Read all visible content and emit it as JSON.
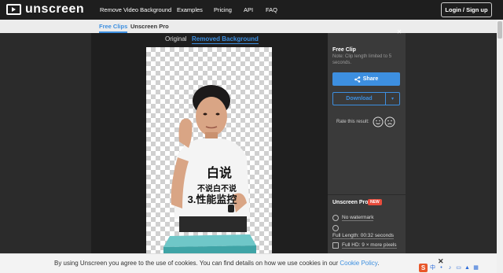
{
  "brand": {
    "name": "unscreen"
  },
  "nav": {
    "items": [
      {
        "label": "Remove Video Background"
      },
      {
        "label": "Examples"
      },
      {
        "label": "Pricing"
      },
      {
        "label": "API"
      },
      {
        "label": "FAQ"
      }
    ],
    "login_label": "Login / Sign up"
  },
  "subnav": {
    "tabs": [
      {
        "label": "Free Clips",
        "active": true
      },
      {
        "label": "Unscreen Pro",
        "active": false
      }
    ]
  },
  "view_tabs": {
    "original": "Original",
    "removed": "Removed Background"
  },
  "video": {
    "caption_line1": "白说",
    "caption_line2": "不说白不说",
    "caption_line3": "3.性能监控"
  },
  "panel": {
    "close_glyph": "✕",
    "title": "Free Clip",
    "note": "Note: Clip length limited to 5 seconds.",
    "share_label": "Share",
    "download_label": "Download",
    "rate_label": "Rate this result:",
    "pro": {
      "title": "Unscreen Pro",
      "badge": "NEW",
      "features": [
        {
          "text": "No watermark"
        },
        {
          "text": ""
        },
        {
          "text": "Full Length: 00:32 seconds"
        },
        {
          "text": "Full HD: 9 × more pixels"
        }
      ]
    }
  },
  "cookie": {
    "text": "By using Unscreen you agree to the use of cookies. You can find details on how we use cookies in our ",
    "link": "Cookie Policy",
    "suffix": ".",
    "close_glyph": "✕"
  },
  "ime": {
    "logo_char": "S",
    "lang_char": "中"
  },
  "colors": {
    "accent": "#3d8fe0",
    "nav_bg": "#1e1e1e",
    "panel_bg": "#3a3a3a",
    "badge": "#e74c3c"
  }
}
